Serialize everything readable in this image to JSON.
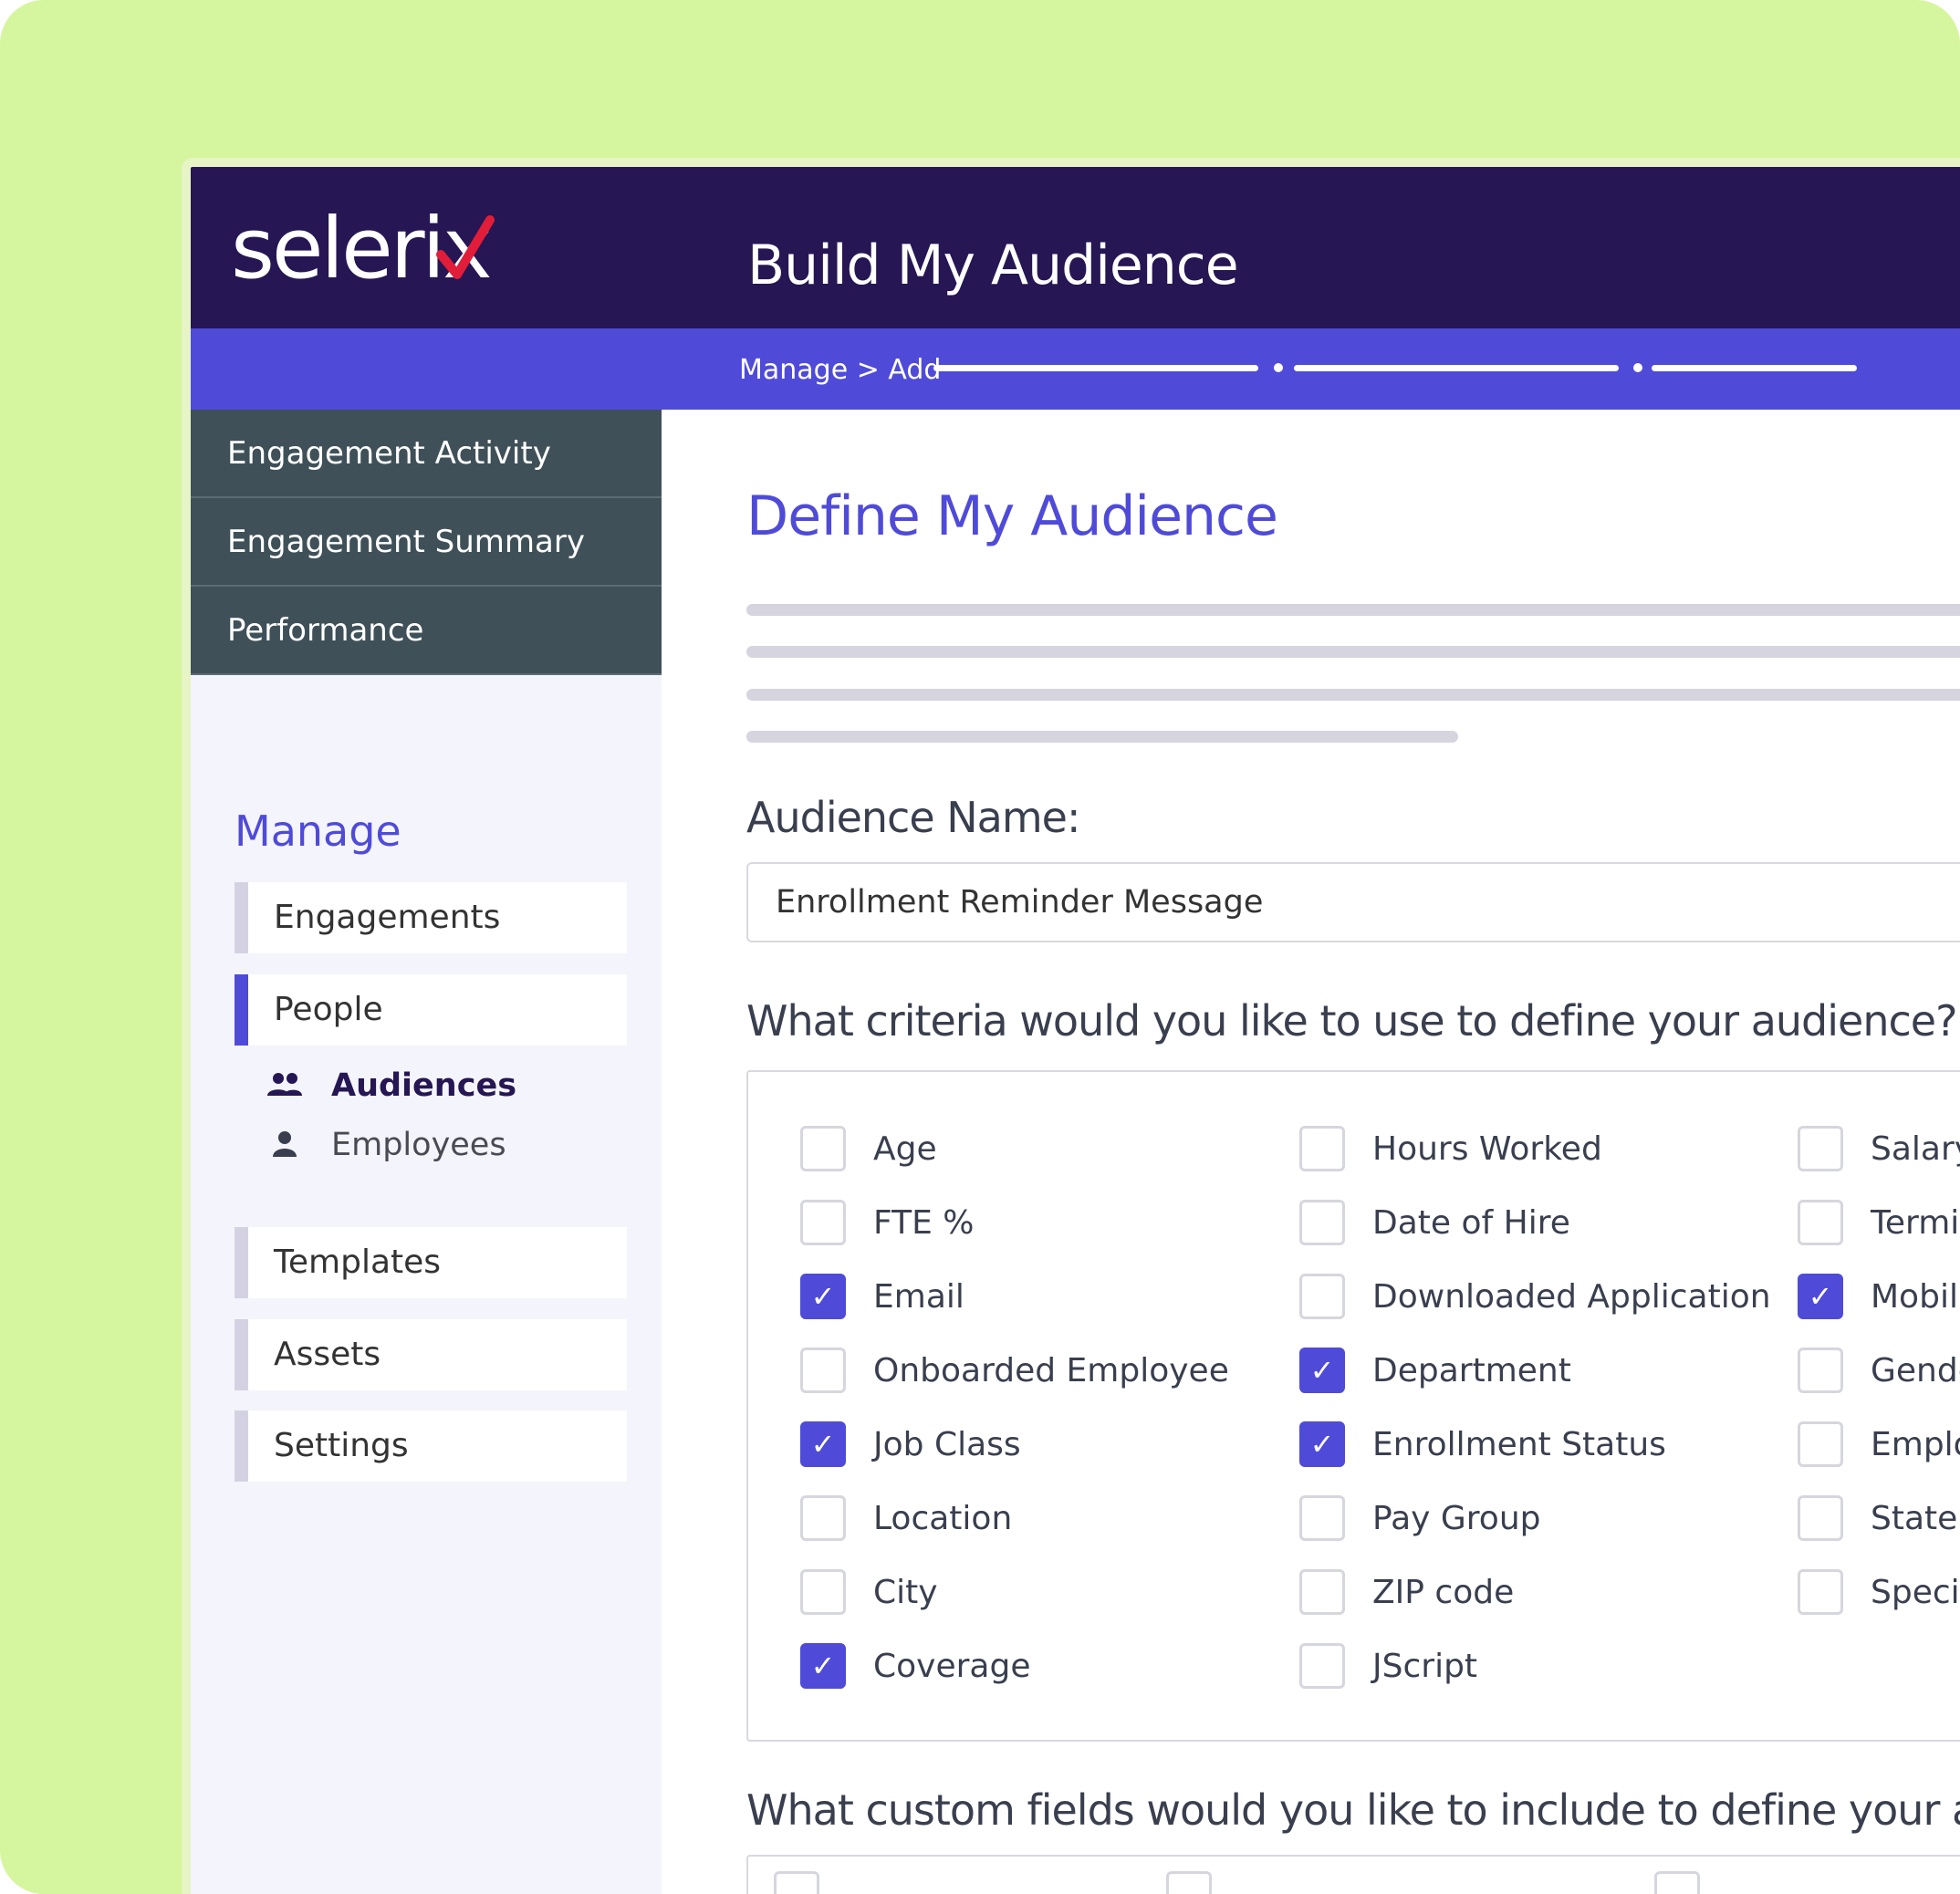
{
  "colors": {
    "background": "#d5f69e",
    "header": "#261653",
    "accent": "#4f4bd8",
    "sidebar_dark": "#3f5058",
    "logo_check": "#e11d3a"
  },
  "app": {
    "logo_text": "seleri",
    "logo_last": "x",
    "title": "Build My Audience",
    "breadcrumb": "Manage > Add"
  },
  "sidebar": {
    "top_items": [
      {
        "label": "Engagement Activity"
      },
      {
        "label": "Engagement Summary"
      },
      {
        "label": "Performance"
      }
    ],
    "manage_title": "Manage",
    "nav": [
      {
        "label": "Engagements"
      },
      {
        "label": "People"
      },
      {
        "label": "Templates"
      },
      {
        "label": "Assets"
      },
      {
        "label": "Settings"
      }
    ],
    "sub_items": [
      {
        "label": "Audiences",
        "icon": "people-icon"
      },
      {
        "label": "Employees",
        "icon": "person-icon"
      }
    ]
  },
  "main": {
    "heading": "Define My Audience",
    "audience_name_label": "Audience Name:",
    "audience_name_value": "Enrollment Reminder Message",
    "criteria_question": "What criteria would you like to use to define your audience?",
    "custom_question": "What custom fields would you like to include to define your audie",
    "criteria": [
      {
        "label": "Age",
        "checked": false
      },
      {
        "label": "FTE %",
        "checked": false
      },
      {
        "label": "Email",
        "checked": true
      },
      {
        "label": "Onboarded Employee",
        "checked": false
      },
      {
        "label": "Job Class",
        "checked": true
      },
      {
        "label": "Location",
        "checked": false
      },
      {
        "label": "City",
        "checked": false
      },
      {
        "label": "Coverage",
        "checked": true
      },
      {
        "label": "Hours Worked",
        "checked": false
      },
      {
        "label": "Date of Hire",
        "checked": false
      },
      {
        "label": "Downloaded Application",
        "checked": false
      },
      {
        "label": "Department",
        "checked": true
      },
      {
        "label": "Enrollment Status",
        "checked": true
      },
      {
        "label": "Pay Group",
        "checked": false
      },
      {
        "label": "ZIP code",
        "checked": false
      },
      {
        "label": "JScript",
        "checked": false
      },
      {
        "label": "Salary",
        "checked": false
      },
      {
        "label": "Termir",
        "checked": false
      },
      {
        "label": "Mobile",
        "checked": true
      },
      {
        "label": "Gende",
        "checked": false
      },
      {
        "label": "Emplo",
        "checked": false
      },
      {
        "label": "State",
        "checked": false
      },
      {
        "label": "Speci",
        "checked": false
      }
    ]
  }
}
